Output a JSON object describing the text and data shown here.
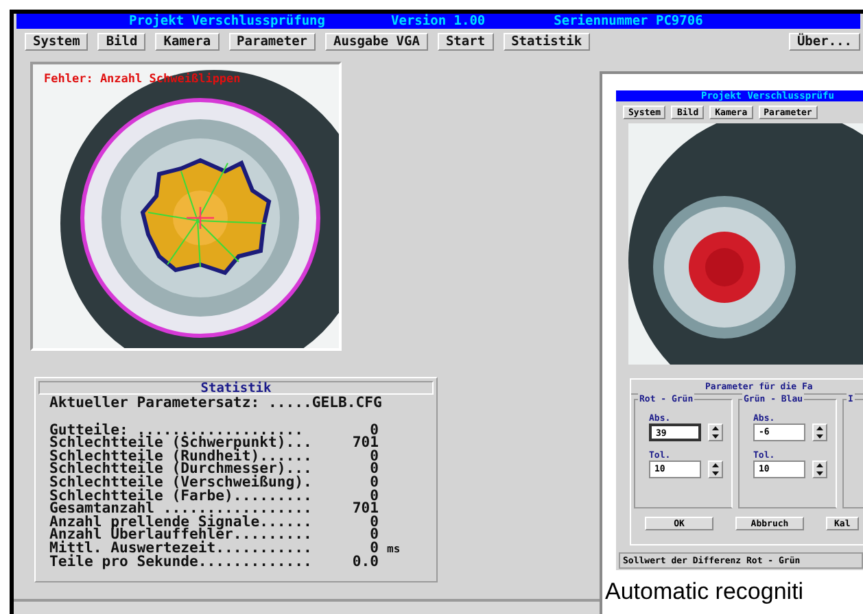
{
  "window": {
    "title_parts": [
      "Projekt Verschlussprüfung",
      "Version 1.00",
      "Seriennummer PC9706"
    ]
  },
  "menu": [
    {
      "label": "System"
    },
    {
      "label": "Bild"
    },
    {
      "label": "Kamera"
    },
    {
      "label": "Parameter"
    },
    {
      "label": "Ausgabe VGA"
    },
    {
      "label": "Start"
    },
    {
      "label": "Statistik"
    },
    {
      "label": "Über..."
    }
  ],
  "image": {
    "overlay_text": "Fehler: Anzahl Schweißlippen"
  },
  "statistics": {
    "title": "Statistik",
    "parameter_set": "Aktueller Parametersatz: .....GELB.CFG",
    "rows": [
      {
        "label": "Gutteile: ...................",
        "value": "0"
      },
      {
        "label": "Schlechtteile (Schwerpunkt)...",
        "value": "701"
      },
      {
        "label": "Schlechtteile (Rundheit)......",
        "value": "0"
      },
      {
        "label": "Schlechtteile (Durchmesser)...",
        "value": "0"
      },
      {
        "label": "Schlechtteile (Verschweißung).",
        "value": "0"
      },
      {
        "label": "Schlechtteile (Farbe).........",
        "value": "0"
      },
      {
        "label": "Gesamtanzahl .................",
        "value": "701"
      },
      {
        "label": "Anzahl prellende Signale......",
        "value": "0"
      },
      {
        "label": "Anzahl Überlauffehler.........",
        "value": "0"
      },
      {
        "label": "Mittl. Auswertezeit...........",
        "value": "0",
        "unit": "ms"
      },
      {
        "label": "Teile pro Sekunde.............",
        "value": "0.0"
      }
    ]
  },
  "inset": {
    "title": "Projekt Verschlussprüfu",
    "menu": [
      "System",
      "Bild",
      "Kamera",
      "Parameter"
    ],
    "panel_title": "Parameter für die Fa",
    "groups": [
      {
        "title": "Rot - Grün",
        "fields": [
          {
            "label": "Abs.",
            "value": "39",
            "focused": true
          },
          {
            "label": "Tol.",
            "value": "10",
            "focused": false
          }
        ]
      },
      {
        "title": "Grün - Blau",
        "fields": [
          {
            "label": "Abs.",
            "value": "-6",
            "focused": false
          },
          {
            "label": "Tol.",
            "value": "10",
            "focused": false
          }
        ]
      },
      {
        "title": "I"
      }
    ],
    "buttons": [
      "OK",
      "Abbruch",
      "Kal"
    ],
    "status": "Sollwert der Differenz Rot - Grün"
  },
  "caption": "Automatic recogniti"
}
